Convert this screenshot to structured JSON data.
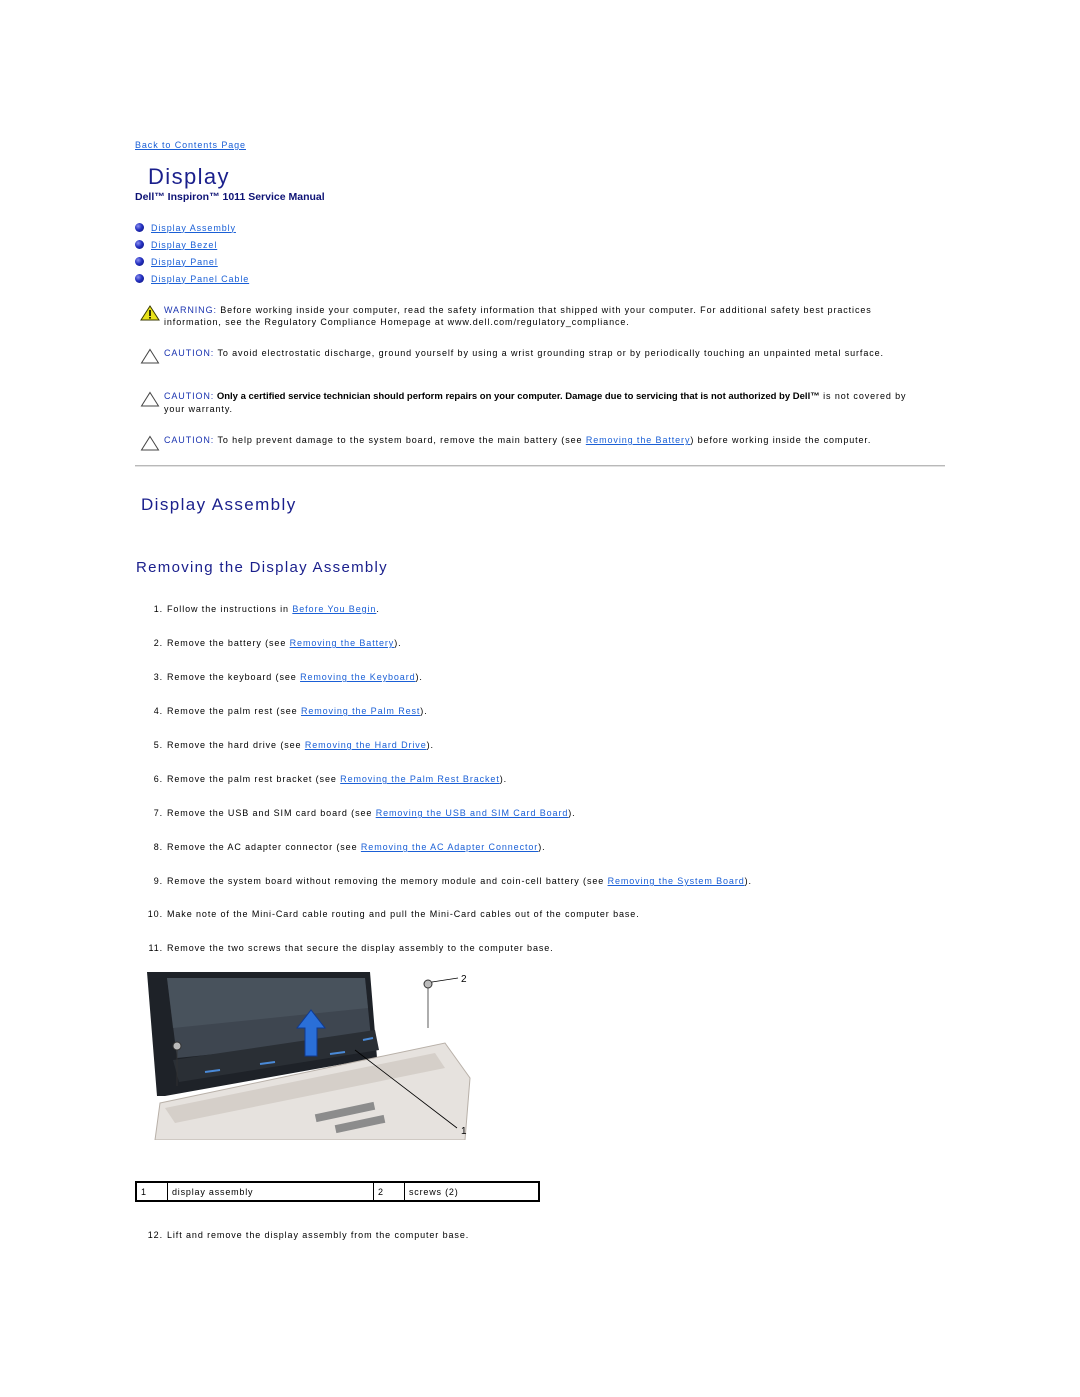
{
  "back_link": "Back to Contents Page",
  "page_title": "Display",
  "manual_title": "Dell™ Inspiron™ 1011 Service Manual",
  "toc": [
    {
      "label": "Display Assembly",
      "icon": "blue-bullet-icon"
    },
    {
      "label": "Display Bezel",
      "icon": "blue-bullet-icon"
    },
    {
      "label": "Display Panel",
      "icon": "blue-bullet-icon"
    },
    {
      "label": "Display Panel Cable",
      "icon": "blue-bullet-icon"
    }
  ],
  "notices": [
    {
      "icon": "warning-triangle-icon",
      "label": "WARNING:",
      "text": " Before working inside your computer, read the safety information that shipped with your computer. For additional safety best practices information, see the Regulatory Compliance Homepage at www.dell.com/regulatory_compliance."
    },
    {
      "icon": "caution-triangle-icon",
      "label": "CAUTION:",
      "text": " To avoid electrostatic discharge, ground yourself by using a wrist grounding strap or by periodically touching an unpainted metal surface."
    },
    {
      "icon": "caution-triangle-icon",
      "label": "CAUTION:",
      "bold": " Only a certified service technician should perform repairs on your computer. Damage due to servicing that is not authorized by Dell™",
      "text": " is not covered by your warranty."
    },
    {
      "icon": "caution-triangle-icon",
      "label": "CAUTION:",
      "text_before": " To help prevent damage to the system board, remove the main battery (see ",
      "link": "Removing the Battery",
      "text_after": ") before working inside the computer."
    }
  ],
  "section_title": "Display Assembly",
  "subsection_title": "Removing the Display Assembly",
  "steps": [
    {
      "num": "1.",
      "before": "Follow the instructions in ",
      "link": "Before You Begin",
      "after": "."
    },
    {
      "num": "2.",
      "before": "Remove the battery (see ",
      "link": "Removing the Battery",
      "after": ")."
    },
    {
      "num": "3.",
      "before": "Remove the keyboard (see ",
      "link": "Removing the Keyboard",
      "after": ")."
    },
    {
      "num": "4.",
      "before": "Remove the palm rest (see ",
      "link": "Removing the Palm Rest",
      "after": ")."
    },
    {
      "num": "5.",
      "before": "Remove the hard drive (see ",
      "link": "Removing the Hard Drive",
      "after": ")."
    },
    {
      "num": "6.",
      "before": "Remove the palm rest bracket (see ",
      "link": "Removing the Palm Rest Bracket",
      "after": ")."
    },
    {
      "num": "7.",
      "before": "Remove the USB and SIM card board (see ",
      "link": "Removing the USB and SIM Card Board",
      "after": ")."
    },
    {
      "num": "8.",
      "before": "Remove the AC adapter connector (see ",
      "link": "Removing the AC Adapter Connector",
      "after": ")."
    },
    {
      "num": "9.",
      "before": "Remove the system board without removing the memory module and coin-cell battery (see ",
      "link": "Removing the System Board",
      "after": ")."
    },
    {
      "num": "10.",
      "before": "Make note of the Mini-Card cable routing and pull the Mini-Card cables out of the computer base.",
      "link": "",
      "after": ""
    },
    {
      "num": "11.",
      "before": "Remove the two screws that secure the display assembly to the computer base.",
      "link": "",
      "after": ""
    }
  ],
  "figure": {
    "callout_1": "1",
    "callout_2": "2"
  },
  "callout_table": [
    {
      "num": "1",
      "label": "display assembly"
    },
    {
      "num": "2",
      "label": "screws (2)"
    }
  ],
  "final_step": {
    "num": "12.",
    "text": "Lift and remove the display assembly from the computer base."
  }
}
